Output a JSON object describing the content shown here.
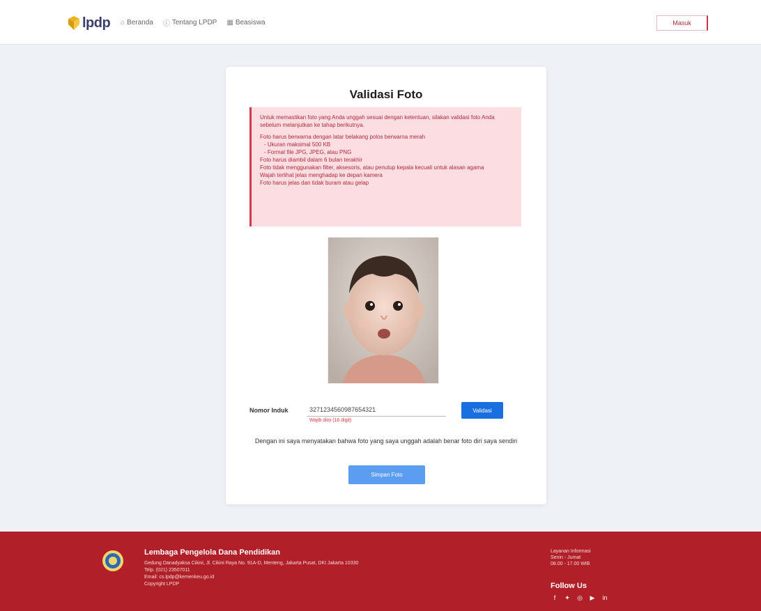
{
  "header": {
    "logo_text": "lpdp",
    "nav_items": [
      {
        "icon": "home-icon",
        "label": "Beranda"
      },
      {
        "icon": "info-icon",
        "label": "Tentang LPDP"
      },
      {
        "icon": "grid-icon",
        "label": "Beasiswa"
      }
    ],
    "login_label": "Masuk"
  },
  "card": {
    "title": "Validasi Foto",
    "alert_intro": "Untuk memastikan foto yang Anda unggah sesuai dengan ketentuan, silakan validasi foto Anda sebelum melanjutkan ke tahap berikutnya.",
    "alert_items": [
      "Foto harus berwarna dengan latar belakang polos berwarna merah",
      "- Ukuran maksimal 500 KB",
      "- Format file JPG, JPEG, atau PNG",
      "Foto harus diambil dalam 6 bulan terakhir",
      "Foto tidak menggunakan filter, aksesoris, atau penutup kepala kecuali untuk alasan agama",
      "Wajah terlihat jelas menghadap ke depan kamera",
      "Foto harus jelas dan tidak buram atau gelap"
    ],
    "form_label": "Nomor Induk",
    "input_value": "3271234560987654321",
    "input_hint": "Wajib diisi (16 digit)",
    "submit_label": "Validasi",
    "note_text": "Dengan ini saya menyatakan bahwa foto yang saya unggah adalah benar foto diri saya sendiri",
    "verify_label": "Simpan Foto"
  },
  "footer": {
    "org_name": "Lembaga Pengelola Dana Pendidikan",
    "desc_lines": [
      "Gedung Danadyaksa Cikini, Jl. Cikini Raya No. 91A-D, Menteng, Jakarta Pusat, DKI Jakarta 10330",
      "Telp. (021) 23507011",
      "Email: cs.lpdp@kemenkeu.go.id",
      "Copyright LPDP"
    ],
    "contact_lines": [
      "Layanan Informasi",
      "Senin - Jumat",
      "08.00 - 17.00 WIB"
    ],
    "follow_label": "Follow Us",
    "social_icons": [
      "facebook-icon",
      "twitter-icon",
      "instagram-icon",
      "youtube-icon",
      "linkedin-icon"
    ],
    "accent_color": "#b12028"
  }
}
